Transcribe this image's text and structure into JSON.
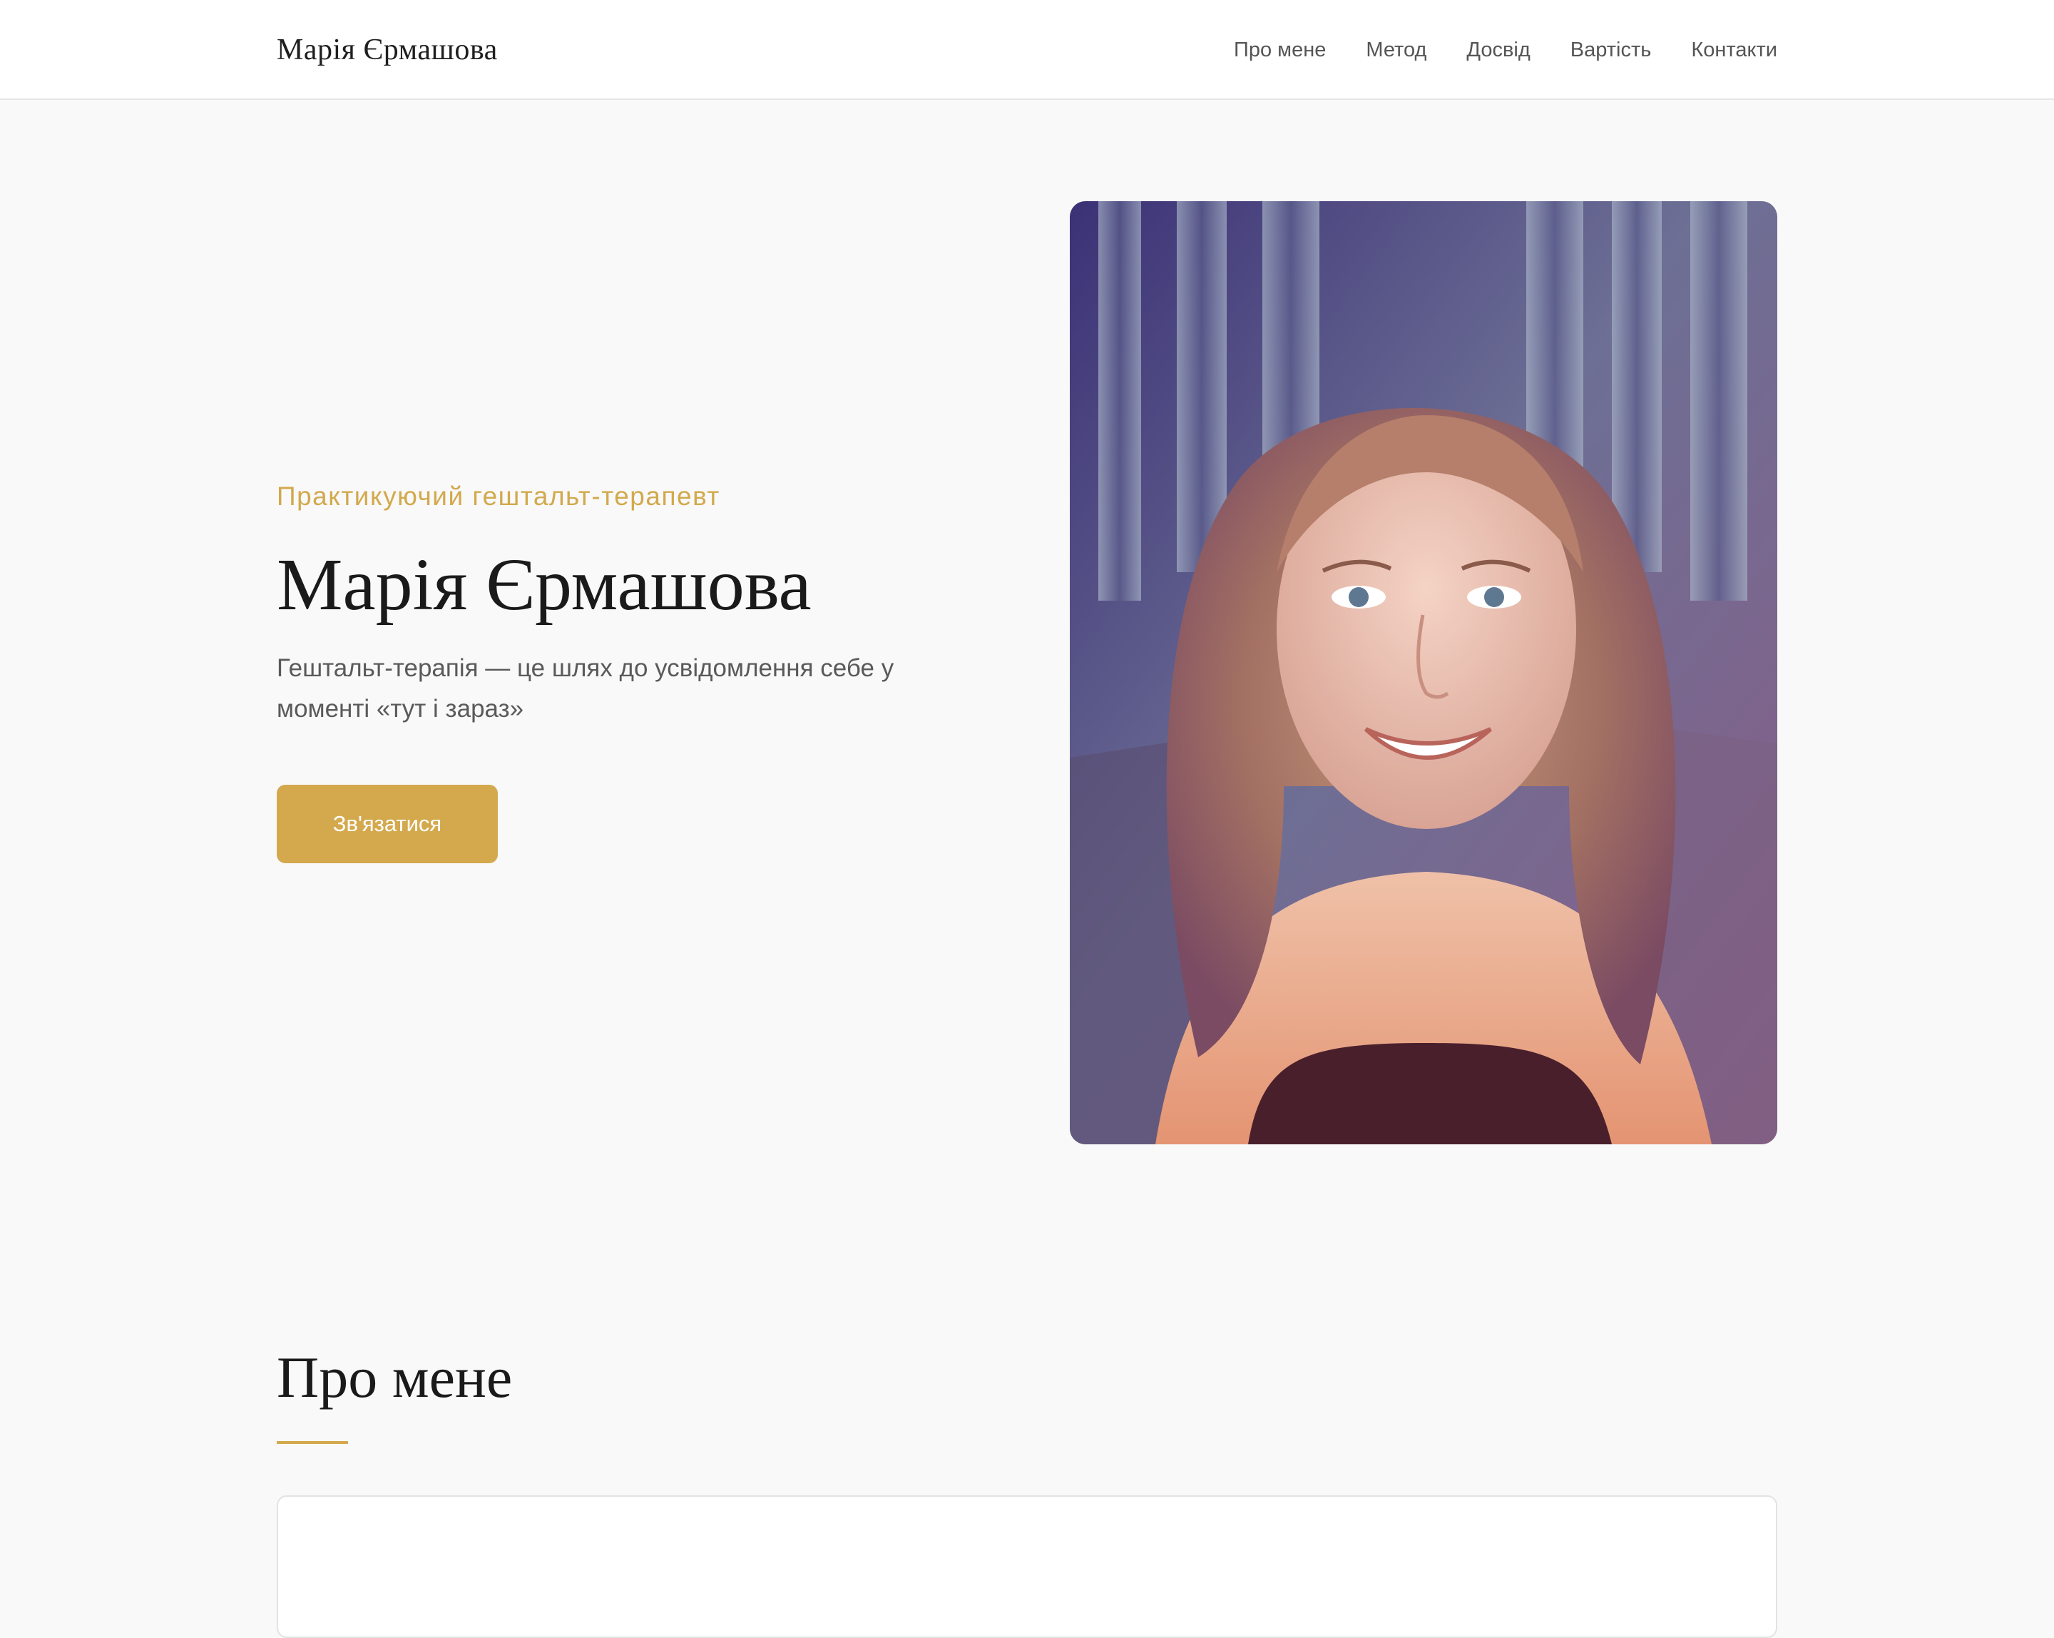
{
  "header": {
    "logo": "Марія Єрмашова",
    "nav": [
      "Про мене",
      "Метод",
      "Досвід",
      "Вартість",
      "Контакти"
    ]
  },
  "hero": {
    "eyebrow": "Практикуючий гештальт-терапевт",
    "title": "Марія Єрмашова",
    "subtitle": "Гештальт-терапія — це шлях до усвідомлення себе у моменті «тут і зараз»",
    "cta": "Зв'язатися"
  },
  "about": {
    "title": "Про мене",
    "text": ""
  },
  "colors": {
    "accent": "#d4a94e",
    "background": "#f9f9f9",
    "header_bg": "#ffffff",
    "text": "#1f1f1f",
    "muted": "#5a5a5a"
  }
}
